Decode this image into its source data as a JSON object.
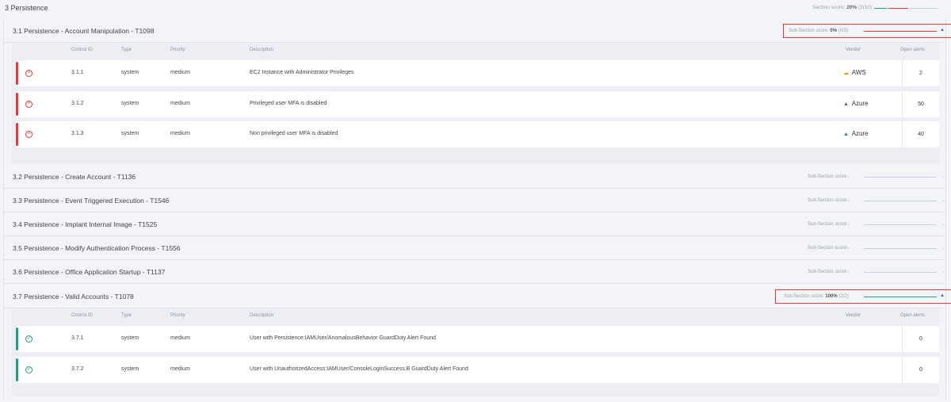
{
  "section": {
    "title": "3 Persistence",
    "score_label": "Section score:",
    "score_value": "20%",
    "score_detail": "(2/10)"
  },
  "columns": {
    "control_id": "Control ID",
    "type": "Type",
    "priority": "Priority",
    "description": "Description",
    "vendor": "Vendor",
    "open_alerts": "Open alerts"
  },
  "subsections": [
    {
      "title": "3.1 Persistence - Account Manipulation - T1098",
      "score_label": "Sub-Section score:",
      "score_value": "0%",
      "score_detail": "(0/3)",
      "controls": [
        {
          "id": "3.1.1",
          "type": "system",
          "priority": "medium",
          "description": "EC2 Instance with Administrator Privileges",
          "vendor": "AWS",
          "vendor_icon": "aws-icon",
          "open_alerts": "2",
          "status": "fail"
        },
        {
          "id": "3.1.2",
          "type": "system",
          "priority": "medium",
          "description": "Privileged user MFA is disabled",
          "vendor": "Azure",
          "vendor_icon": "azure-icon",
          "open_alerts": "50",
          "status": "fail"
        },
        {
          "id": "3.1.3",
          "type": "system",
          "priority": "medium",
          "description": "Non privileged user MFA is disabled",
          "vendor": "Azure",
          "vendor_icon": "azure-icon",
          "open_alerts": "40",
          "status": "fail"
        }
      ]
    },
    {
      "title": "3.2 Persistence - Create Account - T1136",
      "score_label": "Sub-Section score:-"
    },
    {
      "title": "3.3 Persistence - Event Triggered Execution - T1546",
      "score_label": "Sub-Section score:-"
    },
    {
      "title": "3.4 Persistence - Implant Internal Image - T1525",
      "score_label": "Sub-Section score:-"
    },
    {
      "title": "3.5 Persistence - Modify Authentication Process - T1556",
      "score_label": "Sub-Section score:-"
    },
    {
      "title": "3.6 Persistence - Office Application Startup - T1137",
      "score_label": "Sub-Section score:-"
    },
    {
      "title": "3.7 Persistence - Valid Accounts - T1078",
      "score_label": "Sub-Section score:",
      "score_value": "100%",
      "score_detail": "(2/2)",
      "controls": [
        {
          "id": "3.7.1",
          "type": "system",
          "priority": "medium",
          "description": "User with Persistence:IAMUser/AnomalousBehavior GuardDuty Alert Found",
          "vendor": "",
          "open_alerts": "0",
          "status": "pass"
        },
        {
          "id": "3.7.2",
          "type": "system",
          "priority": "medium",
          "description": "User with UnauthorizedAccess:IAMUser/ConsoleLoginSuccess.B GuardDuty Alert Found",
          "vendor": "",
          "open_alerts": "0",
          "status": "pass"
        }
      ]
    }
  ],
  "colors": {
    "fail": "#e53935",
    "pass": "#1aa37a",
    "neutral_bar": "#c9cde0",
    "highlight": "#e53935",
    "chevron": "#2e6ab1"
  }
}
